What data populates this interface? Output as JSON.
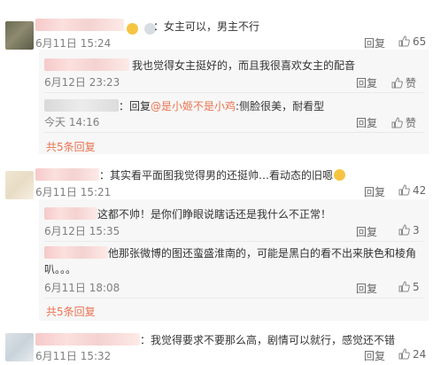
{
  "comments": [
    {
      "text_suffix": "：女主可以，男主不行",
      "time": "6月11日 15:24",
      "reply_label": "回复",
      "like_count": "65"
    },
    {
      "text": "：其实看平面图我觉得男的还挺帅…看动态的旧嗯",
      "time": "6月11日 15:21",
      "reply_label": "回复",
      "like_count": "42"
    },
    {
      "text": "：我觉得要求不要那么高，剧情可以就行，感觉还不错",
      "time": "6月11日 15:32",
      "reply_label": "回复",
      "like_count": "24"
    }
  ],
  "replies_1": [
    {
      "text": "我也觉得女主挺好的，而且我很喜欢女主的配音",
      "time": "6月12日 23:23",
      "reply_label": "回复",
      "like_label": "赞"
    },
    {
      "text_prefix": "：回复",
      "mention": "@是小姬不是小鸡",
      "text_suffix": ":侧脸很美，耐看型",
      "time": "今天 14:16",
      "reply_label": "回复",
      "like_label": "赞"
    }
  ],
  "more_1": "共5条回复",
  "replies_2": [
    {
      "text": "这都不帅！是你们睁眼说瞎话还是我什么不正常！",
      "time": "6月12日 15:35",
      "reply_label": "回复",
      "like_count": "3"
    },
    {
      "text_line1": "他那张微博的图还蛮盛淮南的，可能是黑白的看不出来肤色和棱角",
      "text_line2": "叭。。。",
      "time": "6月11日 18:08",
      "reply_label": "回复",
      "like_count": "5"
    }
  ],
  "more_2": "共5条回复",
  "colors": {
    "accent": "#eb7350",
    "meta": "#808080",
    "reply_bg": "#f7f7f7"
  }
}
